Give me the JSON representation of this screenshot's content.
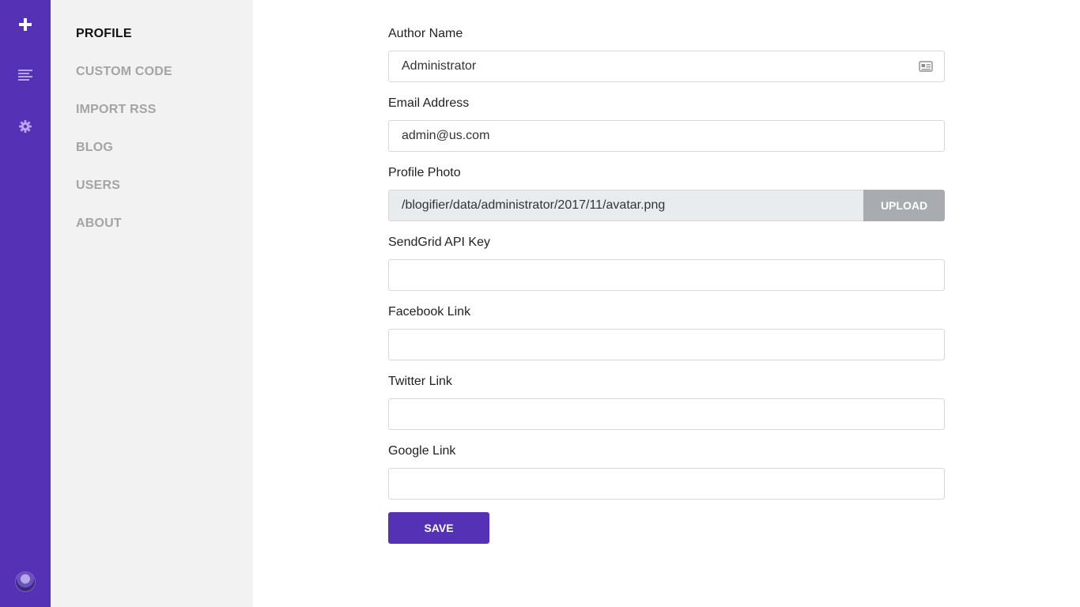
{
  "rail": {
    "items": [
      {
        "icon": "plus-icon"
      },
      {
        "icon": "list-icon"
      },
      {
        "icon": "gear-icon"
      }
    ],
    "avatar": "avatar"
  },
  "subnav": {
    "items": [
      {
        "label": "PROFILE",
        "active": true
      },
      {
        "label": "CUSTOM CODE"
      },
      {
        "label": "IMPORT RSS"
      },
      {
        "label": "BLOG"
      },
      {
        "label": "USERS"
      },
      {
        "label": "ABOUT"
      }
    ]
  },
  "form": {
    "author_name": {
      "label": "Author Name",
      "value": "Administrator",
      "icon": "id-card-icon"
    },
    "email": {
      "label": "Email Address",
      "value": "admin@us.com"
    },
    "profile_photo": {
      "label": "Profile Photo",
      "value": "/blogifier/data/administrator/2017/11/avatar.png",
      "button": "UPLOAD"
    },
    "sendgrid": {
      "label": "SendGrid API Key",
      "value": ""
    },
    "facebook": {
      "label": "Facebook Link",
      "value": ""
    },
    "twitter": {
      "label": "Twitter Link",
      "value": ""
    },
    "google": {
      "label": "Google Link",
      "value": ""
    },
    "save_label": "SAVE"
  },
  "colors": {
    "accent": "#5531b5",
    "subnav_bg": "#f2f2f2",
    "inactive_text": "#a4a4a4"
  }
}
